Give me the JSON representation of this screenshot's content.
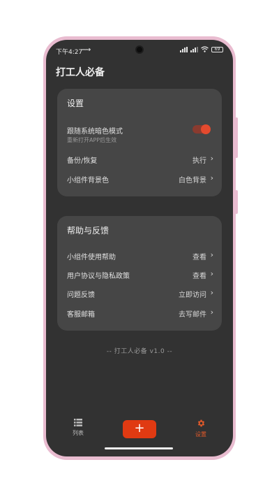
{
  "status": {
    "time": "下午4:27",
    "battery": "69"
  },
  "app": {
    "title": "打工人必备"
  },
  "settings_card": {
    "title": "设置",
    "dark_mode": {
      "label": "跟随系统暗色模式",
      "sub": "重新打开APP后生效",
      "enabled": true
    },
    "backup": {
      "label": "备份/恢复",
      "value": "执行"
    },
    "widget_bg": {
      "label": "小组件背景色",
      "value": "白色背景"
    }
  },
  "help_card": {
    "title": "帮助与反馈",
    "items": [
      {
        "label": "小组件使用帮助",
        "value": "查看"
      },
      {
        "label": "用户协议与隐私政策",
        "value": "查看"
      },
      {
        "label": "问题反馈",
        "value": "立即访问"
      },
      {
        "label": "客服邮箱",
        "value": "去写邮件"
      }
    ]
  },
  "footer": {
    "version": "-- 打工人必备 v1.0 --"
  },
  "nav": {
    "list_label": "列表",
    "add_label": "+",
    "settings_label": "设置"
  },
  "colors": {
    "accent": "#e03a12",
    "background": "#323232",
    "card": "#464646"
  },
  "chevron": "›"
}
